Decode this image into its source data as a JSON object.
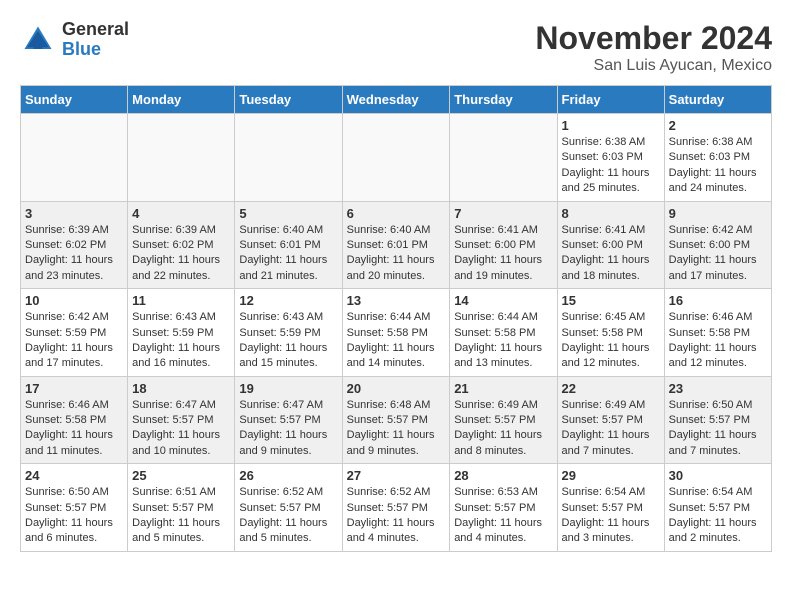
{
  "header": {
    "logo_general": "General",
    "logo_blue": "Blue",
    "month_title": "November 2024",
    "location": "San Luis Ayucan, Mexico"
  },
  "days_of_week": [
    "Sunday",
    "Monday",
    "Tuesday",
    "Wednesday",
    "Thursday",
    "Friday",
    "Saturday"
  ],
  "weeks": [
    {
      "shaded": false,
      "days": [
        {
          "num": "",
          "info": ""
        },
        {
          "num": "",
          "info": ""
        },
        {
          "num": "",
          "info": ""
        },
        {
          "num": "",
          "info": ""
        },
        {
          "num": "",
          "info": ""
        },
        {
          "num": "1",
          "info": "Sunrise: 6:38 AM\nSunset: 6:03 PM\nDaylight: 11 hours and 25 minutes."
        },
        {
          "num": "2",
          "info": "Sunrise: 6:38 AM\nSunset: 6:03 PM\nDaylight: 11 hours and 24 minutes."
        }
      ]
    },
    {
      "shaded": true,
      "days": [
        {
          "num": "3",
          "info": "Sunrise: 6:39 AM\nSunset: 6:02 PM\nDaylight: 11 hours and 23 minutes."
        },
        {
          "num": "4",
          "info": "Sunrise: 6:39 AM\nSunset: 6:02 PM\nDaylight: 11 hours and 22 minutes."
        },
        {
          "num": "5",
          "info": "Sunrise: 6:40 AM\nSunset: 6:01 PM\nDaylight: 11 hours and 21 minutes."
        },
        {
          "num": "6",
          "info": "Sunrise: 6:40 AM\nSunset: 6:01 PM\nDaylight: 11 hours and 20 minutes."
        },
        {
          "num": "7",
          "info": "Sunrise: 6:41 AM\nSunset: 6:00 PM\nDaylight: 11 hours and 19 minutes."
        },
        {
          "num": "8",
          "info": "Sunrise: 6:41 AM\nSunset: 6:00 PM\nDaylight: 11 hours and 18 minutes."
        },
        {
          "num": "9",
          "info": "Sunrise: 6:42 AM\nSunset: 6:00 PM\nDaylight: 11 hours and 17 minutes."
        }
      ]
    },
    {
      "shaded": false,
      "days": [
        {
          "num": "10",
          "info": "Sunrise: 6:42 AM\nSunset: 5:59 PM\nDaylight: 11 hours and 17 minutes."
        },
        {
          "num": "11",
          "info": "Sunrise: 6:43 AM\nSunset: 5:59 PM\nDaylight: 11 hours and 16 minutes."
        },
        {
          "num": "12",
          "info": "Sunrise: 6:43 AM\nSunset: 5:59 PM\nDaylight: 11 hours and 15 minutes."
        },
        {
          "num": "13",
          "info": "Sunrise: 6:44 AM\nSunset: 5:58 PM\nDaylight: 11 hours and 14 minutes."
        },
        {
          "num": "14",
          "info": "Sunrise: 6:44 AM\nSunset: 5:58 PM\nDaylight: 11 hours and 13 minutes."
        },
        {
          "num": "15",
          "info": "Sunrise: 6:45 AM\nSunset: 5:58 PM\nDaylight: 11 hours and 12 minutes."
        },
        {
          "num": "16",
          "info": "Sunrise: 6:46 AM\nSunset: 5:58 PM\nDaylight: 11 hours and 12 minutes."
        }
      ]
    },
    {
      "shaded": true,
      "days": [
        {
          "num": "17",
          "info": "Sunrise: 6:46 AM\nSunset: 5:58 PM\nDaylight: 11 hours and 11 minutes."
        },
        {
          "num": "18",
          "info": "Sunrise: 6:47 AM\nSunset: 5:57 PM\nDaylight: 11 hours and 10 minutes."
        },
        {
          "num": "19",
          "info": "Sunrise: 6:47 AM\nSunset: 5:57 PM\nDaylight: 11 hours and 9 minutes."
        },
        {
          "num": "20",
          "info": "Sunrise: 6:48 AM\nSunset: 5:57 PM\nDaylight: 11 hours and 9 minutes."
        },
        {
          "num": "21",
          "info": "Sunrise: 6:49 AM\nSunset: 5:57 PM\nDaylight: 11 hours and 8 minutes."
        },
        {
          "num": "22",
          "info": "Sunrise: 6:49 AM\nSunset: 5:57 PM\nDaylight: 11 hours and 7 minutes."
        },
        {
          "num": "23",
          "info": "Sunrise: 6:50 AM\nSunset: 5:57 PM\nDaylight: 11 hours and 7 minutes."
        }
      ]
    },
    {
      "shaded": false,
      "days": [
        {
          "num": "24",
          "info": "Sunrise: 6:50 AM\nSunset: 5:57 PM\nDaylight: 11 hours and 6 minutes."
        },
        {
          "num": "25",
          "info": "Sunrise: 6:51 AM\nSunset: 5:57 PM\nDaylight: 11 hours and 5 minutes."
        },
        {
          "num": "26",
          "info": "Sunrise: 6:52 AM\nSunset: 5:57 PM\nDaylight: 11 hours and 5 minutes."
        },
        {
          "num": "27",
          "info": "Sunrise: 6:52 AM\nSunset: 5:57 PM\nDaylight: 11 hours and 4 minutes."
        },
        {
          "num": "28",
          "info": "Sunrise: 6:53 AM\nSunset: 5:57 PM\nDaylight: 11 hours and 4 minutes."
        },
        {
          "num": "29",
          "info": "Sunrise: 6:54 AM\nSunset: 5:57 PM\nDaylight: 11 hours and 3 minutes."
        },
        {
          "num": "30",
          "info": "Sunrise: 6:54 AM\nSunset: 5:57 PM\nDaylight: 11 hours and 2 minutes."
        }
      ]
    }
  ]
}
